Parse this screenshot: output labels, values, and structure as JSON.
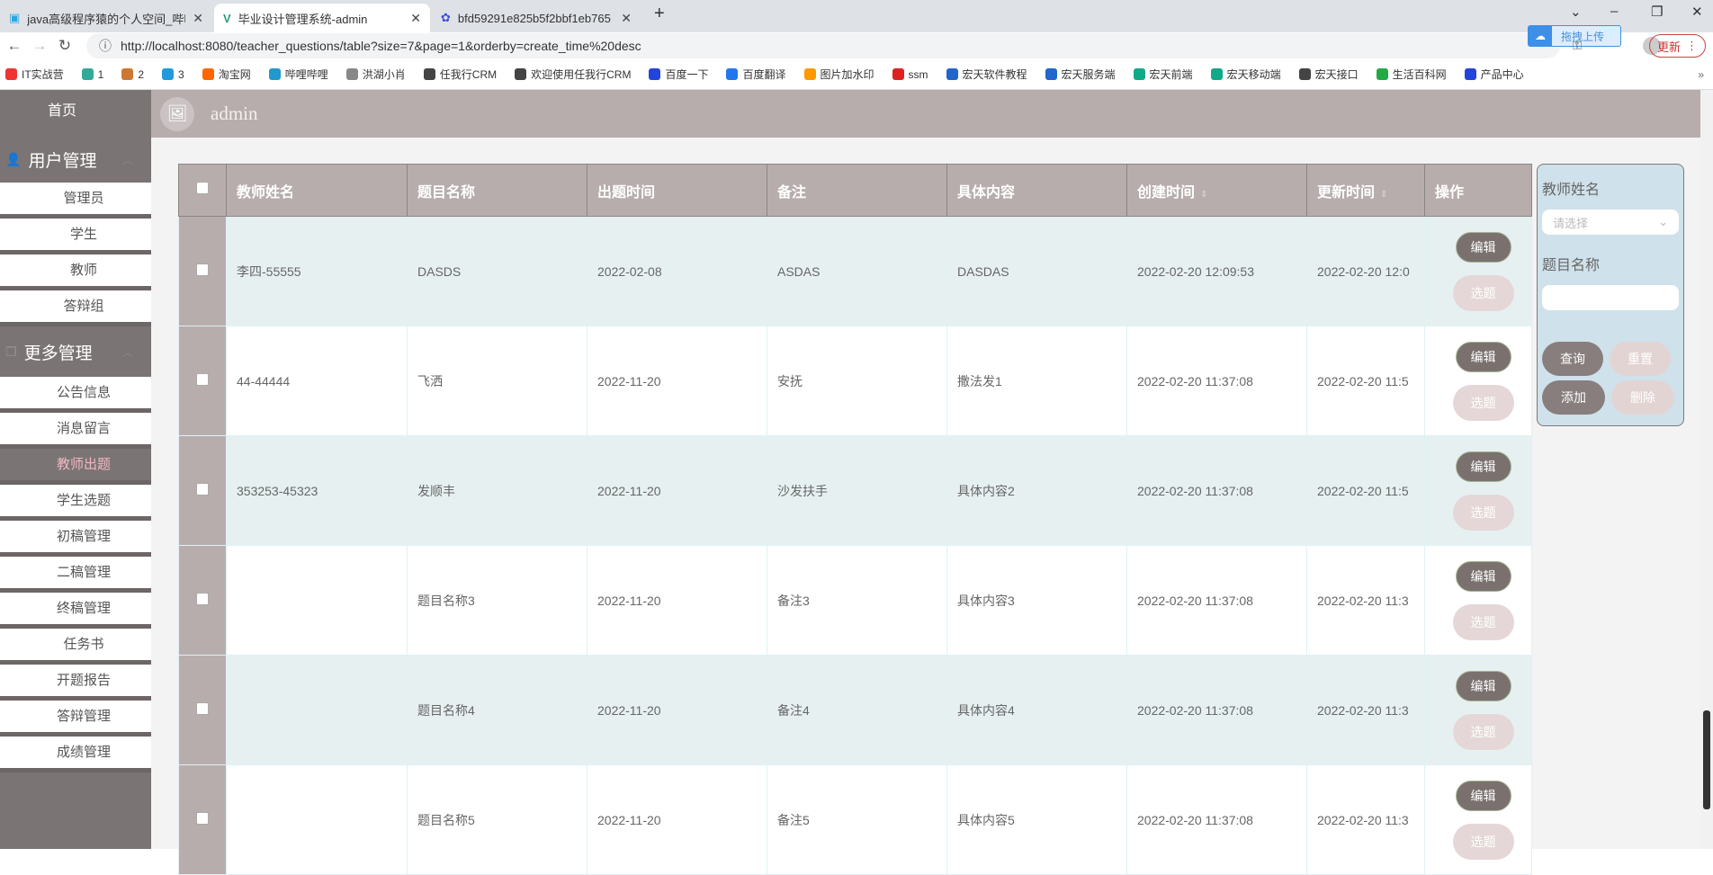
{
  "browser": {
    "tabs": [
      {
        "label": "java高级程序猿的个人空间_哔哩",
        "active": false
      },
      {
        "label": "毕业设计管理系统-admin",
        "active": true
      },
      {
        "label": "bfd59291e825b5f2bbf1eb765",
        "active": false
      }
    ],
    "url": "http://localhost:8080/teacher_questions/table?size=7&page=1&orderby=create_time%20desc",
    "update_label": "更新",
    "drag_upload": "拖拽上传",
    "bookmarks": [
      "IT实战营",
      "1",
      "2",
      "3",
      "淘宝网",
      "哔哩哔哩",
      "洪湖小肖",
      "任我行CRM",
      "欢迎使用任我行CRM",
      "百度一下",
      "百度翻译",
      "图片加水印",
      "ssm",
      "宏天软件教程",
      "宏天服务端",
      "宏天前端",
      "宏天移动端",
      "宏天接口",
      "生活百科网",
      "产品中心"
    ],
    "bookmark_colors": [
      "#e33",
      "#3a9",
      "#c73",
      "#29d",
      "#f60",
      "#29c",
      "#888",
      "#444",
      "#444",
      "#24d",
      "#27e",
      "#f90",
      "#d22",
      "#26c",
      "#26c",
      "#1a8",
      "#1a8",
      "#444",
      "#2a4",
      "#24d"
    ]
  },
  "sidebar": {
    "home": "首页",
    "groups": [
      {
        "title": "用户管理",
        "items": [
          "管理员",
          "学生",
          "教师",
          "答辩组"
        ]
      },
      {
        "title": "更多管理",
        "items": [
          "公告信息",
          "消息留言",
          "教师出题",
          "学生选题",
          "初稿管理",
          "二稿管理",
          "终稿管理",
          "任务书",
          "开题报告",
          "答辩管理",
          "成绩管理"
        ]
      }
    ],
    "active": "教师出题"
  },
  "header": {
    "username": "admin"
  },
  "table": {
    "columns": [
      "教师姓名",
      "题目名称",
      "出题时间",
      "备注",
      "具体内容",
      "创建时间",
      "更新时间",
      "操作"
    ],
    "edit_label": "编辑",
    "select_label": "选题",
    "rows": [
      [
        "李四-55555",
        "DASDS",
        "2022-02-08",
        "ASDAS",
        "DASDAS",
        "2022-02-20 12:09:53",
        "2022-02-20 12:0"
      ],
      [
        "44-44444",
        "飞洒",
        "2022-11-20",
        "安抚",
        "撒法发1",
        "2022-02-20 11:37:08",
        "2022-02-20 11:5"
      ],
      [
        "353253-45323",
        "发顺丰",
        "2022-11-20",
        "沙发扶手",
        "具体内容2",
        "2022-02-20 11:37:08",
        "2022-02-20 11:5"
      ],
      [
        "",
        "题目名称3",
        "2022-11-20",
        "备注3",
        "具体内容3",
        "2022-02-20 11:37:08",
        "2022-02-20 11:3"
      ],
      [
        "",
        "题目名称4",
        "2022-11-20",
        "备注4",
        "具体内容4",
        "2022-02-20 11:37:08",
        "2022-02-20 11:3"
      ],
      [
        "",
        "题目名称5",
        "2022-11-20",
        "备注5",
        "具体内容5",
        "2022-02-20 11:37:08",
        "2022-02-20 11:3"
      ]
    ]
  },
  "search": {
    "teacher_label": "教师姓名",
    "teacher_placeholder": "请选择",
    "title_label": "题目名称",
    "title_value": "",
    "query": "查询",
    "reset": "重置",
    "add": "添加",
    "delete": "删除"
  }
}
